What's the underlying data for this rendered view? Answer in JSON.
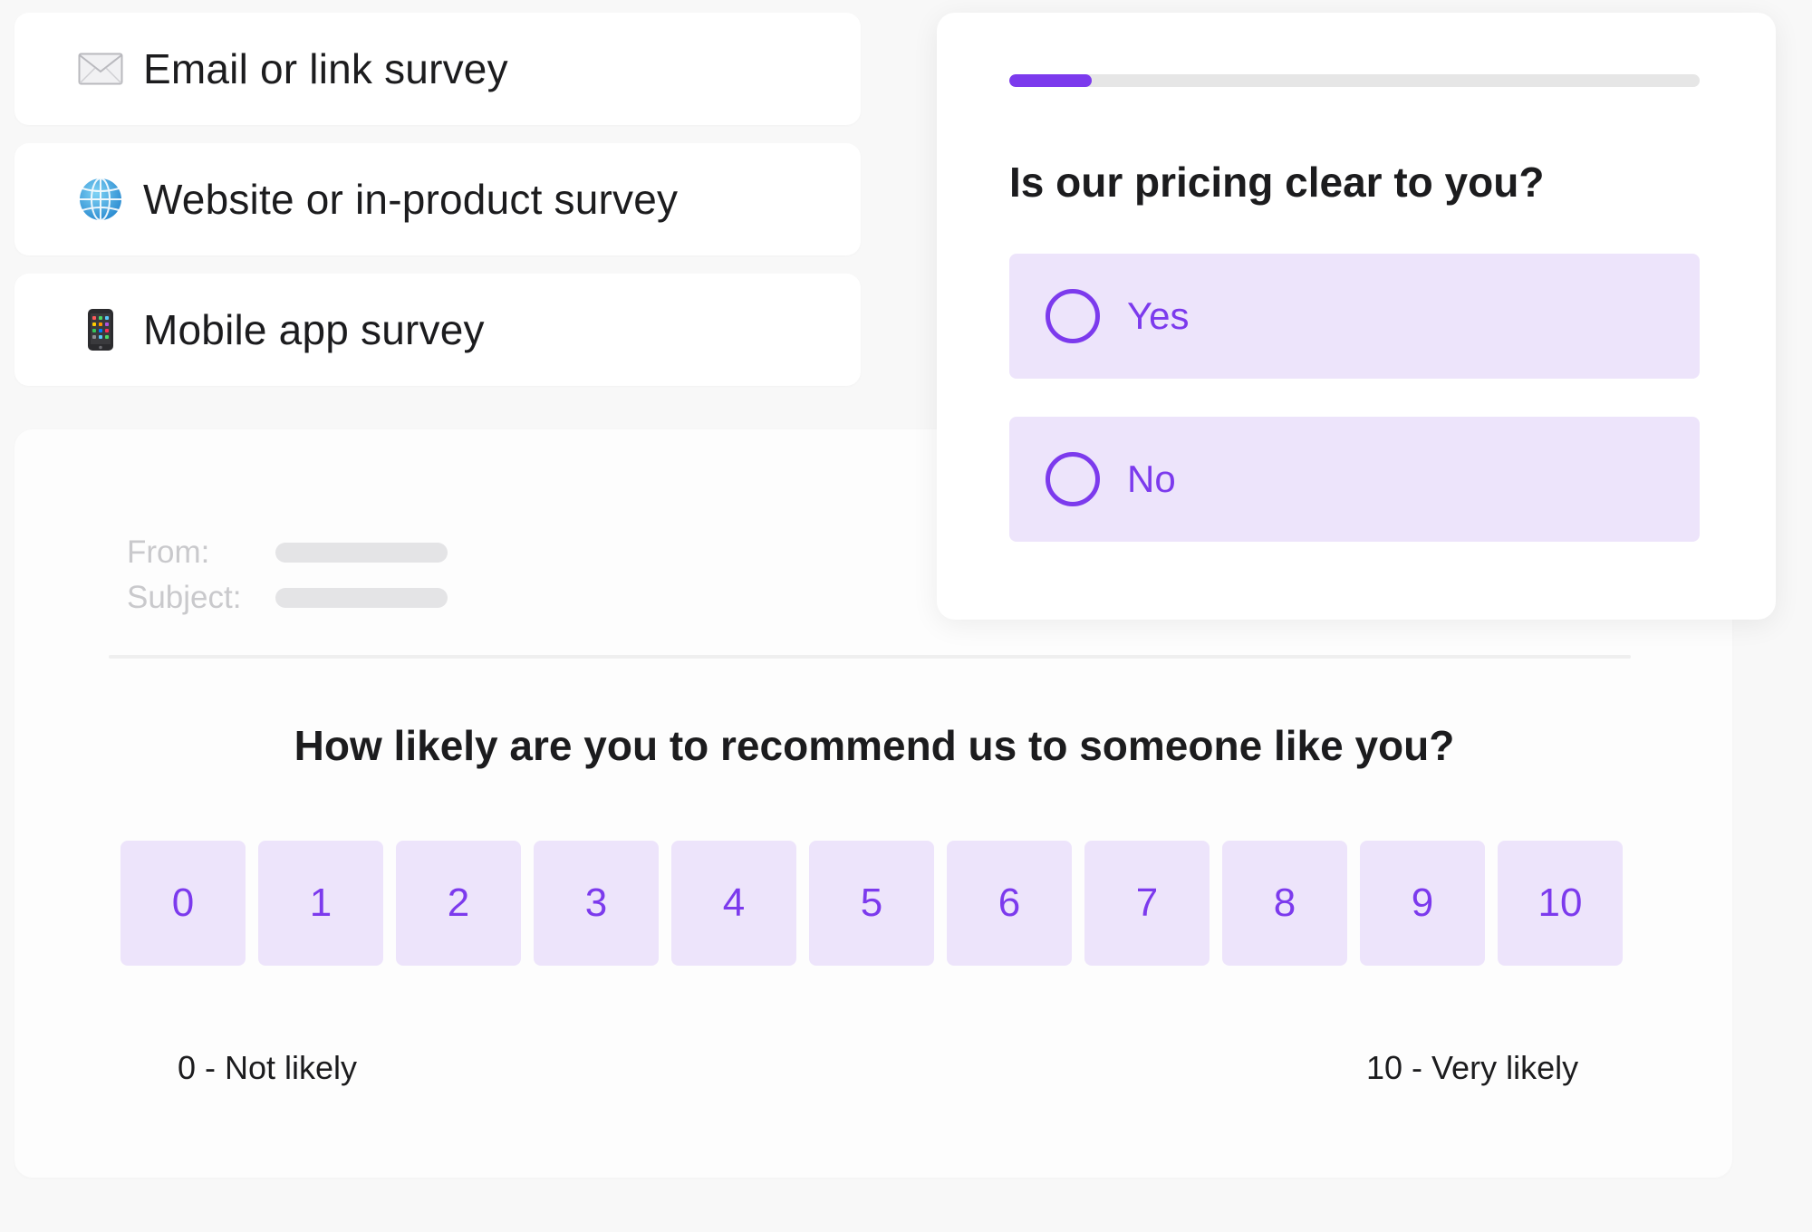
{
  "survey_types": [
    {
      "icon": "envelope-icon",
      "label": "Email or link survey"
    },
    {
      "icon": "globe-icon",
      "label": "Website or in-product survey"
    },
    {
      "icon": "mobile-phone-icon",
      "label": "Mobile app survey"
    }
  ],
  "email_preview": {
    "from_label": "From:",
    "subject_label": "Subject:",
    "question": "How likely are you to recommend us to someone like you?",
    "scale": [
      "0",
      "1",
      "2",
      "3",
      "4",
      "5",
      "6",
      "7",
      "8",
      "9",
      "10"
    ],
    "low_label": "0 - Not likely",
    "high_label": "10 - Very likely"
  },
  "question_card": {
    "progress_percent": 12,
    "question": "Is our pricing clear to you?",
    "options": [
      "Yes",
      "No"
    ]
  },
  "colors": {
    "accent": "#7c3aed",
    "option_bg": "#ede4fb",
    "track": "#e6e6e6"
  }
}
